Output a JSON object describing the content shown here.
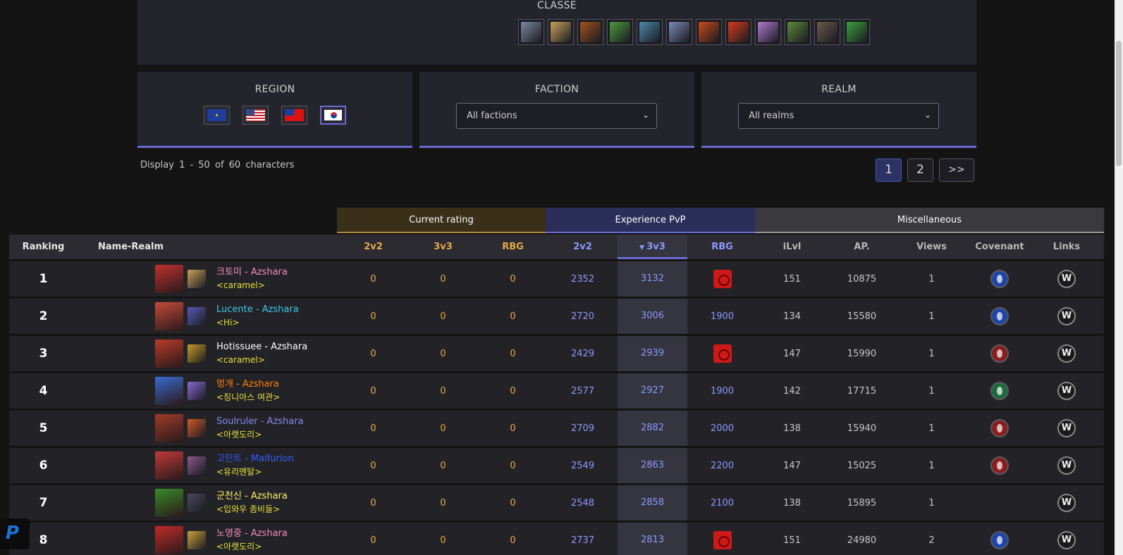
{
  "filters": {
    "classe_title": "CLASSE",
    "class_icons": [
      {
        "name": "warrior-class-icon",
        "color": "#7a8aa0"
      },
      {
        "name": "paladin-class-icon",
        "color": "#c9a15a"
      },
      {
        "name": "hunter-class-icon",
        "color": "#a0521e"
      },
      {
        "name": "rogue-class-icon",
        "color": "#4c9a3c"
      },
      {
        "name": "priest-class-icon",
        "color": "#4a8aa8"
      },
      {
        "name": "deathknight-class-icon",
        "color": "#7a8ab8"
      },
      {
        "name": "shaman-class-icon",
        "color": "#c84a1a"
      },
      {
        "name": "mage-class-icon",
        "color": "#d83a1a"
      },
      {
        "name": "warlock-class-icon",
        "color": "#b07ad0"
      },
      {
        "name": "monk-class-icon",
        "color": "#5a8a3a"
      },
      {
        "name": "druid-class-icon",
        "color": "#6a5a4a"
      },
      {
        "name": "demonhunter-class-icon",
        "color": "#3aa03a"
      }
    ],
    "region": {
      "title": "REGION",
      "flags": [
        {
          "name": "eu-flag-icon",
          "class": "flag-eu",
          "active": false
        },
        {
          "name": "us-flag-icon",
          "class": "flag-us",
          "active": false
        },
        {
          "name": "tw-flag-icon",
          "class": "flag-tw",
          "active": false
        },
        {
          "name": "kr-flag-icon",
          "class": "flag-kr",
          "active": true
        }
      ]
    },
    "faction": {
      "title": "FACTION",
      "selected": "All factions"
    },
    "realm": {
      "title": "REALM",
      "selected": "All realms"
    }
  },
  "display": {
    "label": "Display",
    "range": "1 - 50",
    "of": "of",
    "total": "60 characters"
  },
  "pagination": {
    "pages": [
      "1",
      "2"
    ],
    "active": "1",
    "next": ">>"
  },
  "groups": {
    "current": "Current rating",
    "experience": "Experience PvP",
    "misc": "Miscellaneous"
  },
  "columns": {
    "ranking": "Ranking",
    "name": "Name-Realm",
    "cur_2v2": "2v2",
    "cur_3v3": "3v3",
    "cur_rbg": "RBG",
    "exp_2v2": "2v2",
    "exp_3v3": "3v3",
    "exp_rbg": "RBG",
    "ilvl": "iLvl",
    "ap": "AP.",
    "views": "Views",
    "covenant": "Covenant",
    "links": "Links"
  },
  "rows": [
    {
      "rank": "1",
      "name": "크토미 - Azshara",
      "name_color": "#f48cba",
      "guild": "<caramel>",
      "portrait": "#c03030",
      "spec": "#c9a15a",
      "cur_2v2": "0",
      "cur_3v3": "0",
      "cur_rbg": "0",
      "exp_2v2": "2352",
      "exp_3v3": "3132",
      "exp_rbg": "",
      "rbg_icon": true,
      "ilvl": "151",
      "ap": "10875",
      "views": "1",
      "covenant": "cov-kyrian"
    },
    {
      "rank": "2",
      "name": "Lucente - Azshara",
      "name_color": "#3fc7eb",
      "guild": "<Hi>",
      "portrait": "#c84a3a",
      "spec": "#5a5ab8",
      "cur_2v2": "0",
      "cur_3v3": "0",
      "cur_rbg": "0",
      "exp_2v2": "2720",
      "exp_3v3": "3006",
      "exp_rbg": "1900",
      "rbg_icon": false,
      "ilvl": "134",
      "ap": "15580",
      "views": "1",
      "covenant": "cov-kyrian"
    },
    {
      "rank": "3",
      "name": "Hotissuee - Azshara",
      "name_color": "#ffffff",
      "guild": "<caramel>",
      "portrait": "#b83a2a",
      "spec": "#c89a2a",
      "cur_2v2": "0",
      "cur_3v3": "0",
      "cur_rbg": "0",
      "exp_2v2": "2429",
      "exp_3v3": "2939",
      "exp_rbg": "",
      "rbg_icon": true,
      "ilvl": "147",
      "ap": "15990",
      "views": "1",
      "covenant": "cov-venthyr"
    },
    {
      "rank": "4",
      "name": "멍개 - Azshara",
      "name_color": "#ff7c0a",
      "guild": "<칭니아스 여관>",
      "portrait": "#3a6ad0",
      "spec": "#8a6ad0",
      "cur_2v2": "0",
      "cur_3v3": "0",
      "cur_rbg": "0",
      "exp_2v2": "2577",
      "exp_3v3": "2927",
      "exp_rbg": "1900",
      "rbg_icon": false,
      "ilvl": "142",
      "ap": "17715",
      "views": "1",
      "covenant": "cov-fae"
    },
    {
      "rank": "5",
      "name": "Soulruler - Azshara",
      "name_color": "#8788ee",
      "guild": "<아랫도리>",
      "portrait": "#a03a2a",
      "spec": "#d05a2a",
      "cur_2v2": "0",
      "cur_3v3": "0",
      "cur_rbg": "0",
      "exp_2v2": "2709",
      "exp_3v3": "2882",
      "exp_rbg": "2000",
      "rbg_icon": false,
      "ilvl": "138",
      "ap": "15940",
      "views": "1",
      "covenant": "cov-venthyr"
    },
    {
      "rank": "6",
      "name": "고민트 - Malfurion",
      "name_color": "#2f5dff",
      "guild": "<유리멘탈>",
      "portrait": "#c03a3a",
      "spec": "#8a5a8a",
      "cur_2v2": "0",
      "cur_3v3": "0",
      "cur_rbg": "0",
      "exp_2v2": "2549",
      "exp_3v3": "2863",
      "exp_rbg": "2200",
      "rbg_icon": false,
      "ilvl": "147",
      "ap": "15025",
      "views": "1",
      "covenant": "cov-venthyr"
    },
    {
      "rank": "7",
      "name": "군천신 - Azshara",
      "name_color": "#fff468",
      "guild": "<입와우 좀비들>",
      "portrait": "#3a8a2a",
      "spec": "#4a4a5a",
      "cur_2v2": "0",
      "cur_3v3": "0",
      "cur_rbg": "0",
      "exp_2v2": "2548",
      "exp_3v3": "2858",
      "exp_rbg": "2100",
      "rbg_icon": false,
      "ilvl": "138",
      "ap": "15895",
      "views": "1",
      "covenant": ""
    },
    {
      "rank": "8",
      "name": "노영중 - Azshara",
      "name_color": "#f48cba",
      "guild": "<아랫도리>",
      "portrait": "#c02a2a",
      "spec": "#c8a03a",
      "cur_2v2": "0",
      "cur_3v3": "0",
      "cur_rbg": "0",
      "exp_2v2": "2737",
      "exp_3v3": "2813",
      "exp_rbg": "",
      "rbg_icon": true,
      "ilvl": "151",
      "ap": "24980",
      "views": "2",
      "covenant": "cov-kyrian"
    }
  ],
  "links_icon_letter": "W",
  "paypal_letter": "P"
}
